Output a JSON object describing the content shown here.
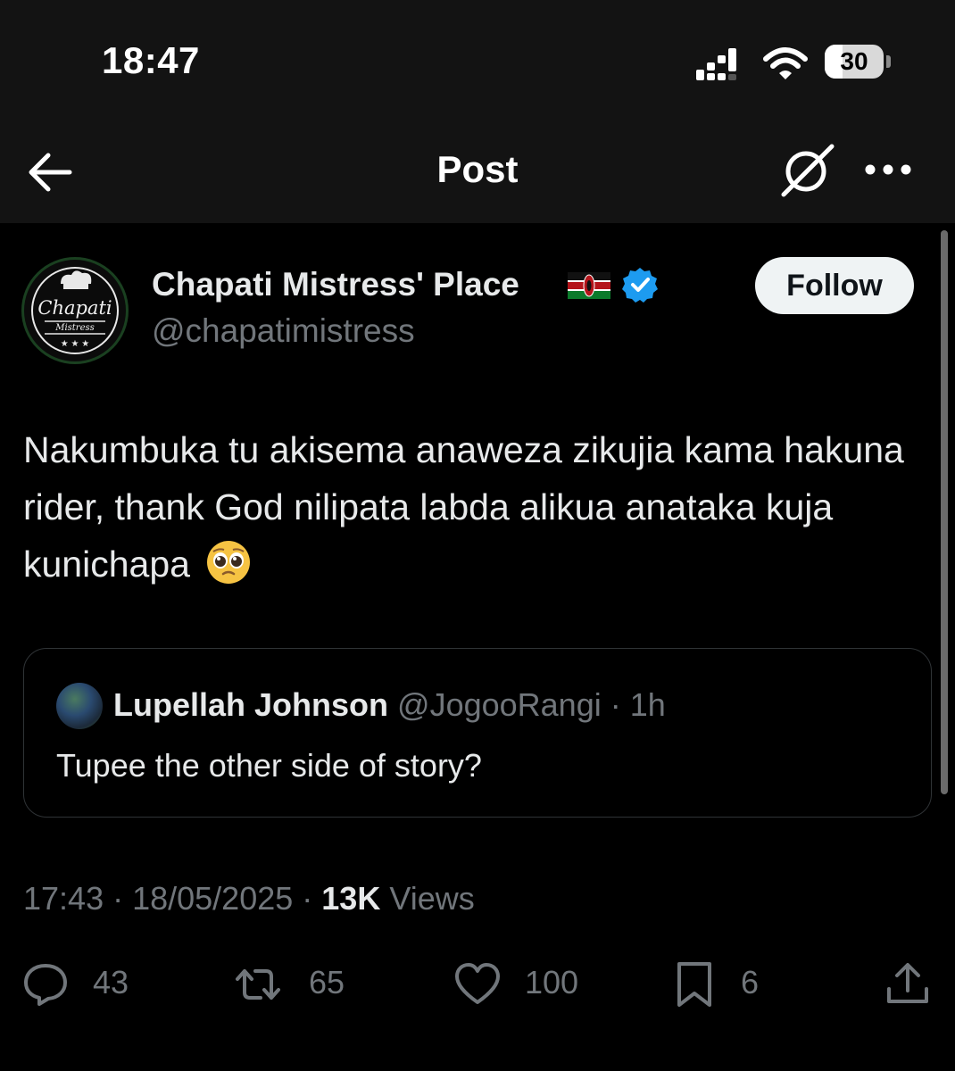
{
  "status_bar": {
    "time": "18:47",
    "battery": "30",
    "battery_level": 0.3,
    "icons": [
      "signal-icon",
      "wifi-icon",
      "battery-icon"
    ]
  },
  "nav": {
    "title": "Post",
    "icons": [
      "back-arrow-icon",
      "grok-icon",
      "more-icon"
    ]
  },
  "author": {
    "name": "Chapati Mistress' Place",
    "handle": "@chapatimistress",
    "avatar_logo_text": "Chapati Mistress",
    "follow_label": "Follow"
  },
  "post": {
    "text": "Nakumbuka tu akisema anaweza zikujia kama hakuna rider, thank God nilipata labda alikua anataka kuja kunichapa"
  },
  "quote": {
    "name": "Lupellah Johnson",
    "handle": "@JogooRangi",
    "meta": " · 1h",
    "text": "Tupee the other side of story?"
  },
  "meta": {
    "time": "17:43",
    "date": "18/05/2025",
    "views": "13K",
    "views_label": "Views"
  },
  "actions": {
    "replies": "43",
    "reposts": "65",
    "likes": "100",
    "bookmarks": "6"
  },
  "colors": {
    "background": "#000000",
    "text": "#e7e9ea",
    "muted": "#71767b",
    "verified": "#1d9bf0"
  }
}
